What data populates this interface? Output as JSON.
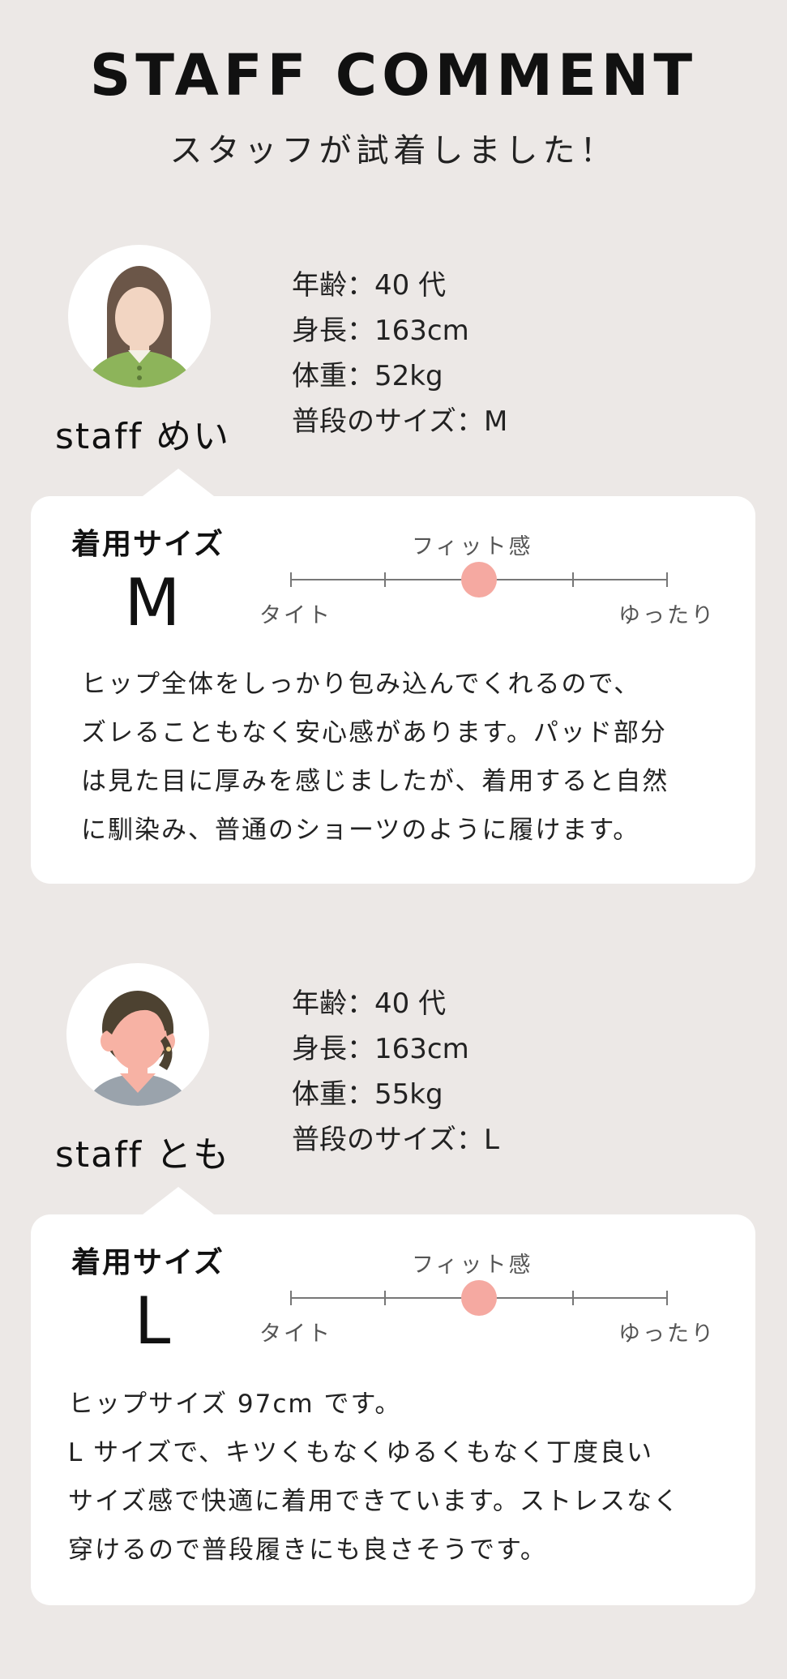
{
  "header": {
    "title": "STAFF COMMENT",
    "subtitle": "スタッフが試着しました！"
  },
  "staff": [
    {
      "name": "staff めい",
      "info": [
        "年齢：40 代",
        "身長：163cm",
        "体重：52kg",
        "普段のサイズ：M"
      ],
      "size_label": "着用サイズ",
      "size_value": "M",
      "fit": {
        "title": "フィット感",
        "left_label": "タイト",
        "right_label": "ゆったり",
        "position_fraction": 0.5
      },
      "comment_lines": [
        "ヒップ全体をしっかり包み込んでくれるので、",
        "ズレることもなく安心感があります。パッド部分",
        "は見た目に厚みを感じましたが、着用すると自然",
        "に馴染み、普通のショーツのように履けます。"
      ],
      "avatar_icon": "woman-avatar-icon",
      "colors": {
        "hair": "#6b5648",
        "skin": "#f2d5c2",
        "top": "#8db45a"
      }
    },
    {
      "name": "staff とも",
      "info": [
        "年齢：40 代",
        "身長：163cm",
        "体重：55kg",
        "普段のサイズ：L"
      ],
      "size_label": "着用サイズ",
      "size_value": "L",
      "fit": {
        "title": "フィット感",
        "left_label": "タイト",
        "right_label": "ゆったり",
        "position_fraction": 0.5
      },
      "comment_lines": [
        "ヒップサイズ 97cm です。",
        "L サイズで、キツくもなくゆるくもなく丁度良い",
        "サイズ感で快適に着用できています。ストレスなく",
        "穿けるので普段履きにも良さそうです。"
      ],
      "avatar_icon": "woman-avatar-icon",
      "colors": {
        "hair": "#4d4231",
        "skin": "#f7b2a4",
        "top": "#9aa3ac"
      }
    }
  ],
  "theme": {
    "background": "#ece8e6",
    "card": "#ffffff",
    "fit_dot": "#f5a9a1"
  }
}
